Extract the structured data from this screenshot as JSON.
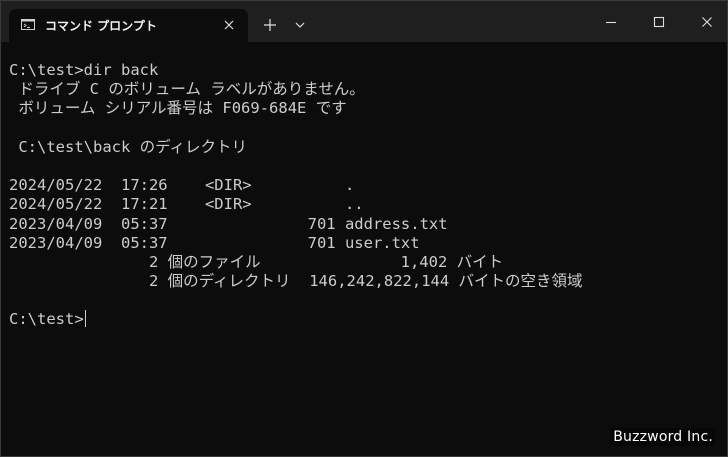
{
  "window": {
    "tab_title": "コマンド プロンプト",
    "icons": {
      "tab": "cmd-icon",
      "close_tab": "close-icon",
      "new_tab": "plus-icon",
      "dropdown": "chevron-down-icon",
      "minimize": "minimize-icon",
      "maximize": "maximize-icon",
      "close": "close-icon"
    }
  },
  "terminal": {
    "lines": [
      "",
      "C:\\test>dir back",
      " ドライブ C のボリューム ラベルがありません。",
      " ボリューム シリアル番号は F069-684E です",
      "",
      " C:\\test\\back のディレクトリ",
      "",
      "2024/05/22  17:26    <DIR>          .",
      "2024/05/22  17:21    <DIR>          ..",
      "2023/04/09  05:37               701 address.txt",
      "2023/04/09  05:37               701 user.txt",
      "               2 個のファイル               1,402 バイト",
      "               2 個のディレクトリ  146,242,822,144 バイトの空き領域",
      ""
    ],
    "prompt": "C:\\test>"
  },
  "watermark": "Buzzword Inc.",
  "colors": {
    "titlebar": "#1f1f1f",
    "background": "#0c0c0c",
    "text": "#cccccc"
  }
}
